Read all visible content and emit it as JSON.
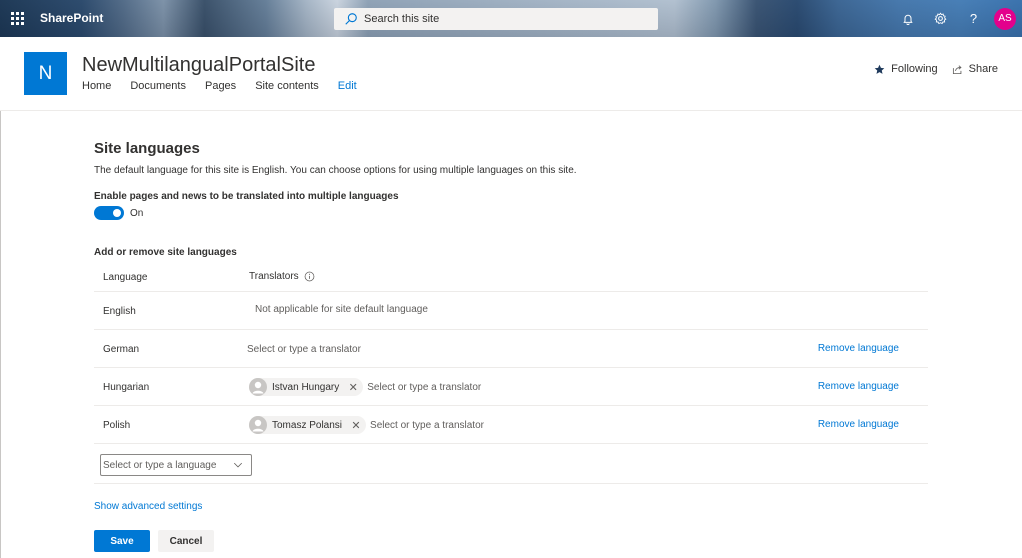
{
  "suite_bar": {
    "brand": "SharePoint",
    "search_placeholder": "Search this site",
    "user_initials": "AS"
  },
  "site_header": {
    "logo_letter": "N",
    "title": "NewMultilangualPortalSite",
    "nav": [
      "Home",
      "Documents",
      "Pages",
      "Site contents",
      "Edit"
    ],
    "following_label": "Following",
    "share_label": "Share"
  },
  "content": {
    "heading": "Site languages",
    "description": "The default language for this site is English. You can choose options for using multiple languages on this site.",
    "toggle_label": "Enable pages and news to be translated into multiple languages",
    "toggle_state": "On",
    "toggle_on": true,
    "section_label": "Add or remove site languages",
    "table": {
      "col_language": "Language",
      "col_translators": "Translators",
      "rows": [
        {
          "language": "English",
          "note": "Not applicable for site default language"
        },
        {
          "language": "German",
          "translator_placeholder": "Select or type a translator",
          "remove_label": "Remove language"
        },
        {
          "language": "Hungarian",
          "translator": "Istvan Hungary",
          "translator_placeholder": "Select or type a translator",
          "remove_label": "Remove language"
        },
        {
          "language": "Polish",
          "translator": "Tomasz Polansi",
          "translator_placeholder": "Select or type a translator",
          "remove_label": "Remove language"
        }
      ]
    },
    "add_language_placeholder": "Select or type a language",
    "advanced_link": "Show advanced settings",
    "save_label": "Save",
    "cancel_label": "Cancel"
  },
  "colors": {
    "accent": "#0078d4",
    "avatar_bg": "#e3008c"
  },
  "icons": {
    "app_launcher": "waffle-icon",
    "search": "search-icon",
    "notifications": "bell-icon",
    "settings": "gear-icon",
    "help": "help-icon",
    "following": "star-icon",
    "share": "share-icon",
    "info": "info-icon",
    "dropdown": "chevron-down-icon",
    "remove": "close-icon"
  }
}
